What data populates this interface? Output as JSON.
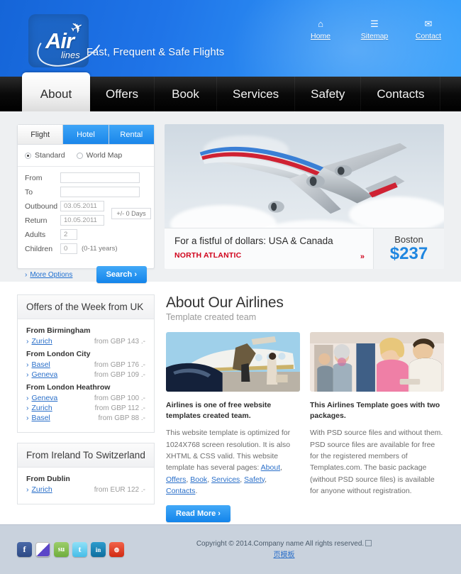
{
  "header": {
    "logo": {
      "air": "Air",
      "lines": "lines",
      "plane_icon": "airplane-icon"
    },
    "tagline": "Fast, Frequent & Safe Flights",
    "toplinks": [
      {
        "label": "Home",
        "icon": "home-icon"
      },
      {
        "label": "Sitemap",
        "icon": "sitemap-icon"
      },
      {
        "label": "Contact",
        "icon": "envelope-icon"
      }
    ]
  },
  "nav": {
    "items": [
      {
        "label": "About",
        "active": true
      },
      {
        "label": "Offers",
        "active": false
      },
      {
        "label": "Book",
        "active": false
      },
      {
        "label": "Services",
        "active": false
      },
      {
        "label": "Safety",
        "active": false
      },
      {
        "label": "Contacts",
        "active": false
      }
    ]
  },
  "booking": {
    "tabs": [
      {
        "label": "Flight",
        "active": true
      },
      {
        "label": "Hotel",
        "active": false
      },
      {
        "label": "Rental",
        "active": false
      }
    ],
    "modes": [
      {
        "label": "Standard",
        "selected": true
      },
      {
        "label": "World Map",
        "selected": false
      }
    ],
    "fields": {
      "from_label": "From",
      "from_value": "",
      "to_label": "To",
      "to_value": "",
      "outbound_label": "Outbound",
      "outbound_value": "03.05.2011",
      "return_label": "Return",
      "return_value": "10.05.2011",
      "adults_label": "Adults",
      "adults_value": "2",
      "children_label": "Children",
      "children_value": "0",
      "children_hint": "(0-11 years)",
      "flex_days": "+/- 0 Days"
    },
    "more_options": "More Options",
    "search_button": "Search  ›"
  },
  "hero": {
    "image_alt": "airliner-climbing-in-clouds",
    "promo_title": "For a fistful of dollars: USA & Canada",
    "promo_subtitle": "NORTH ATLANTIC",
    "promo_arrow": "»",
    "promo_city": "Boston",
    "promo_price": "$237"
  },
  "offers_panels": [
    {
      "heading": "Offers of the Week from UK",
      "groups": [
        {
          "title": "From Birmingham",
          "rows": [
            {
              "city": "Zurich",
              "price": "from GBP  143 .-"
            }
          ]
        },
        {
          "title": "From London City",
          "rows": [
            {
              "city": "Basel",
              "price": "from GBP  176 .-"
            },
            {
              "city": "Geneva",
              "price": "from GBP  109 .-"
            }
          ]
        },
        {
          "title": "From London Heathrow",
          "rows": [
            {
              "city": "Geneva",
              "price": "from GBP  100 .-"
            },
            {
              "city": "Zurich",
              "price": "from GBP  112 .-"
            },
            {
              "city": "Basel",
              "price": "from GBP  88 .-"
            }
          ]
        }
      ]
    },
    {
      "heading": "From Ireland To Switzerland",
      "groups": [
        {
          "title": "From Dublin",
          "rows": [
            {
              "city": "Zurich",
              "price": "from EUR  122 .-"
            }
          ]
        }
      ]
    }
  ],
  "about": {
    "title": "About Our Airlines",
    "subtitle": "Template created team",
    "cards": [
      {
        "image_alt": "private-jet-boarding-photo",
        "lead": "Airlines is one of free website templates created team.",
        "body_before": "This website template is optimized for 1024X768 screen resolution. It is also XHTML & CSS valid. This website template has several pages: ",
        "links": [
          "About",
          "Offers",
          "Book",
          "Services",
          "Safety",
          "Contacts"
        ],
        "body_after": "."
      },
      {
        "image_alt": "passengers-in-cabin-photo",
        "lead": "This Airlines Template goes with two packages.",
        "body_before": "With PSD source files and without them. PSD source files are available for free for the registered members of Templates.com. The basic package (without PSD source files) is available for anyone without registration.",
        "links": [],
        "body_after": ""
      }
    ],
    "read_more": "Read More  ›"
  },
  "footer": {
    "social": [
      {
        "name": "facebook-icon",
        "glyph": "f",
        "color": "#3b5998"
      },
      {
        "name": "delicious-icon",
        "glyph": "",
        "color": "#ffffff"
      },
      {
        "name": "stumbleupon-icon",
        "glyph": "su",
        "color": "#84bf42"
      },
      {
        "name": "twitter-icon",
        "glyph": "t",
        "color": "#62d0f2"
      },
      {
        "name": "linkedin-icon",
        "glyph": "in",
        "color": "#1b86bc"
      },
      {
        "name": "reddit-icon",
        "glyph": "๏",
        "color": "#e03a1e"
      }
    ],
    "copyright": "Copyright © 2014.Company name All rights reserved.",
    "cjk_link": "页模板"
  }
}
